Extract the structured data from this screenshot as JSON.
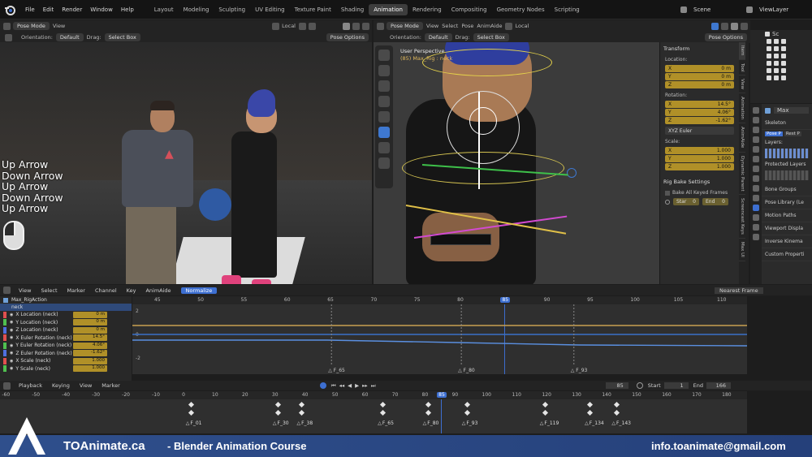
{
  "menubar": {
    "menus": [
      "File",
      "Edit",
      "Render",
      "Window",
      "Help"
    ],
    "workspaces": [
      "Layout",
      "Modeling",
      "Sculpting",
      "UV Editing",
      "Texture Paint",
      "Shading",
      "Animation",
      "Rendering",
      "Compositing",
      "Geometry Nodes",
      "Scripting"
    ],
    "active_workspace": "Animation",
    "scene": "Scene",
    "view_layer": "ViewLayer"
  },
  "left_viewport": {
    "mode": "Pose Mode",
    "view": "View",
    "transform_space": "Local",
    "orientation_label": "Orientation:",
    "orientation": "Default",
    "drag_label": "Drag:",
    "drag": "Select Box",
    "pose_options": "Pose Options"
  },
  "key_overlay": [
    "Up Arrow",
    "Down Arrow",
    "Up Arrow",
    "Down Arrow",
    "Up Arrow"
  ],
  "right_viewport": {
    "mode": "Pose Mode",
    "menus": [
      "View",
      "Select",
      "Pose",
      "AnimAide"
    ],
    "transform_space": "Local",
    "orientation_label": "Orientation:",
    "orientation": "Default",
    "drag_label": "Drag:",
    "drag": "Select Box",
    "pose_options": "Pose Options",
    "title": "User Perspective",
    "subtitle": "(85) Max_Rig : neck"
  },
  "transform_panel": {
    "header": "Transform",
    "location_label": "Location:",
    "location": [
      {
        "axis": "X",
        "value": "0 m"
      },
      {
        "axis": "Y",
        "value": "0 m"
      },
      {
        "axis": "Z",
        "value": "0 m"
      }
    ],
    "rotation_label": "Rotation:",
    "rotation": [
      {
        "axis": "X",
        "value": "14.5°"
      },
      {
        "axis": "Y",
        "value": "4.06°"
      },
      {
        "axis": "Z",
        "value": "-1.62°"
      }
    ],
    "rotation_mode": "XYZ Euler",
    "scale_label": "Scale:",
    "scale": [
      {
        "axis": "X",
        "value": "1.000"
      },
      {
        "axis": "Y",
        "value": "1.000"
      },
      {
        "axis": "Z",
        "value": "1.000"
      }
    ],
    "rig_bake_header": "Rig Bake Settings",
    "bake_all": "Bake All Keyed Frames",
    "start_label": "Star",
    "start_value": "0",
    "end_label": "End",
    "end_value": "0",
    "tabs": [
      "Item",
      "Tool",
      "View",
      "Animation",
      "AnimAide",
      "Dynamic Parent",
      "Screencast Keys",
      "Max UI"
    ]
  },
  "outliner": {
    "root": "Sc"
  },
  "properties": {
    "object": "Max",
    "skeleton": "Skeleton",
    "pose_position": "Pose P",
    "rest_position": "Rest P",
    "layers": "Layers:",
    "protected_layers": "Protected Layers",
    "sections": [
      "Bone Groups",
      "Pose Library (Le",
      "Motion Paths",
      "Viewport Displa",
      "Inverse Kinema",
      "Custom Properti"
    ]
  },
  "graph_editor": {
    "menus": [
      "View",
      "Select",
      "Marker",
      "Channel",
      "Key",
      "AnimAide"
    ],
    "normalize": "Normalize",
    "pivot": "Nearest Frame",
    "ruler": [
      45,
      50,
      55,
      60,
      65,
      70,
      75,
      80,
      85,
      90,
      95,
      100,
      105,
      110
    ],
    "current_frame": "85",
    "y_ticks": [
      "2",
      "0",
      "-2"
    ],
    "rig_name": "Max_RigAction",
    "group": "neck",
    "channels": [
      {
        "name": "X Location (neck)",
        "value": "0 m",
        "color": "#e05050"
      },
      {
        "name": "Y Location (neck)",
        "value": "0 m",
        "color": "#50c050"
      },
      {
        "name": "Z Location (neck)",
        "value": "0 m",
        "color": "#5070e0"
      },
      {
        "name": "X Euler Rotation (neck)",
        "value": "14.5°",
        "color": "#e05050"
      },
      {
        "name": "Y Euler Rotation (neck)",
        "value": "4.06°",
        "color": "#50c050"
      },
      {
        "name": "Z Euler Rotation (neck)",
        "value": "-1.62°",
        "color": "#5070e0"
      },
      {
        "name": "X Scale (neck)",
        "value": "1.000",
        "color": "#e05050"
      },
      {
        "name": "Y Scale (neck)",
        "value": "1.000",
        "color": "#50c050"
      }
    ],
    "markers": [
      "F_65",
      "F_80",
      "F_93"
    ]
  },
  "timeline": {
    "menus": [
      "Playback",
      "Keying",
      "View",
      "Marker"
    ],
    "current_frame": "85",
    "start_label": "Start",
    "start": "1",
    "end_label": "End",
    "end": "166",
    "ruler": [
      "-60",
      "-50",
      "-40",
      "-30",
      "-20",
      "-10",
      "0",
      "10",
      "20",
      "30",
      "40",
      "50",
      "60",
      "70",
      "80",
      "90",
      "100",
      "110",
      "120",
      "130",
      "140",
      "150",
      "160",
      "170",
      "180"
    ],
    "markers": [
      "F_01",
      "F_30",
      "F_38",
      "F_65",
      "F_80",
      "F_93",
      "F_119",
      "F_134",
      "F_143"
    ]
  },
  "footer": {
    "title": "TOAnimate.ca",
    "course": "- Blender Animation Course",
    "email": "info.toanimate@gmail.com"
  },
  "colors": {
    "accent": "#3d6fd1",
    "field": "#b09028",
    "banner": "#2f4f8c"
  }
}
